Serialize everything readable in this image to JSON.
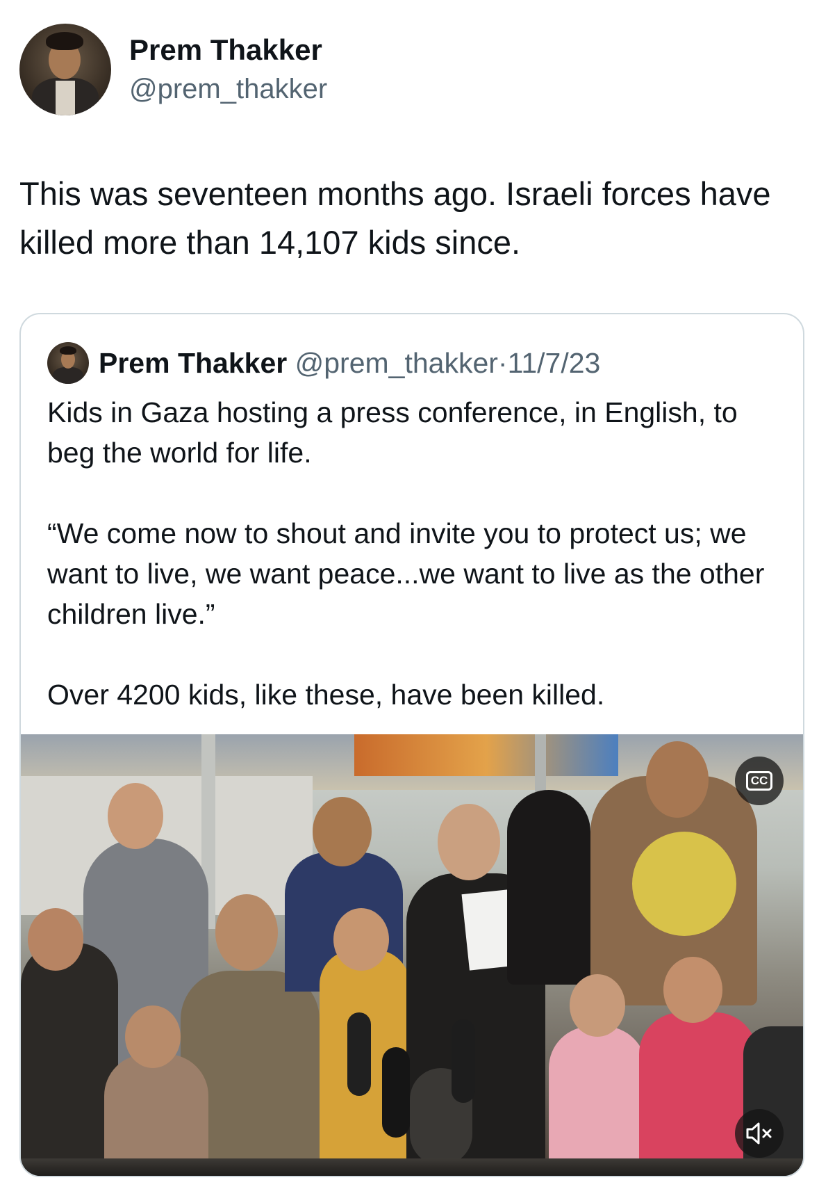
{
  "tweet": {
    "author_name": "Prem Thakker",
    "author_handle": "@prem_thakker",
    "text": "This was seventeen months ago. Israeli forces have killed more than 14,107 kids since."
  },
  "quoted": {
    "author_name": "Prem Thakker",
    "author_handle": "@prem_thakker",
    "separator": "·",
    "date": "11/7/23",
    "paragraphs": [
      "Kids in Gaza hosting a press conference, in English, to beg the world for life.",
      "“We come now to shout and invite you to protect us; we want to live, we want peace...we want to live as the other children live.”",
      "Over 4200 kids, like these, have been killed."
    ],
    "media": {
      "type": "video",
      "cc_label": "CC",
      "cc_icon": "closed-captions-icon",
      "mute_icon": "speaker-muted-icon"
    }
  },
  "colors": {
    "text_primary": "#0f1419",
    "text_secondary": "#536471",
    "border": "#cfd9de"
  }
}
